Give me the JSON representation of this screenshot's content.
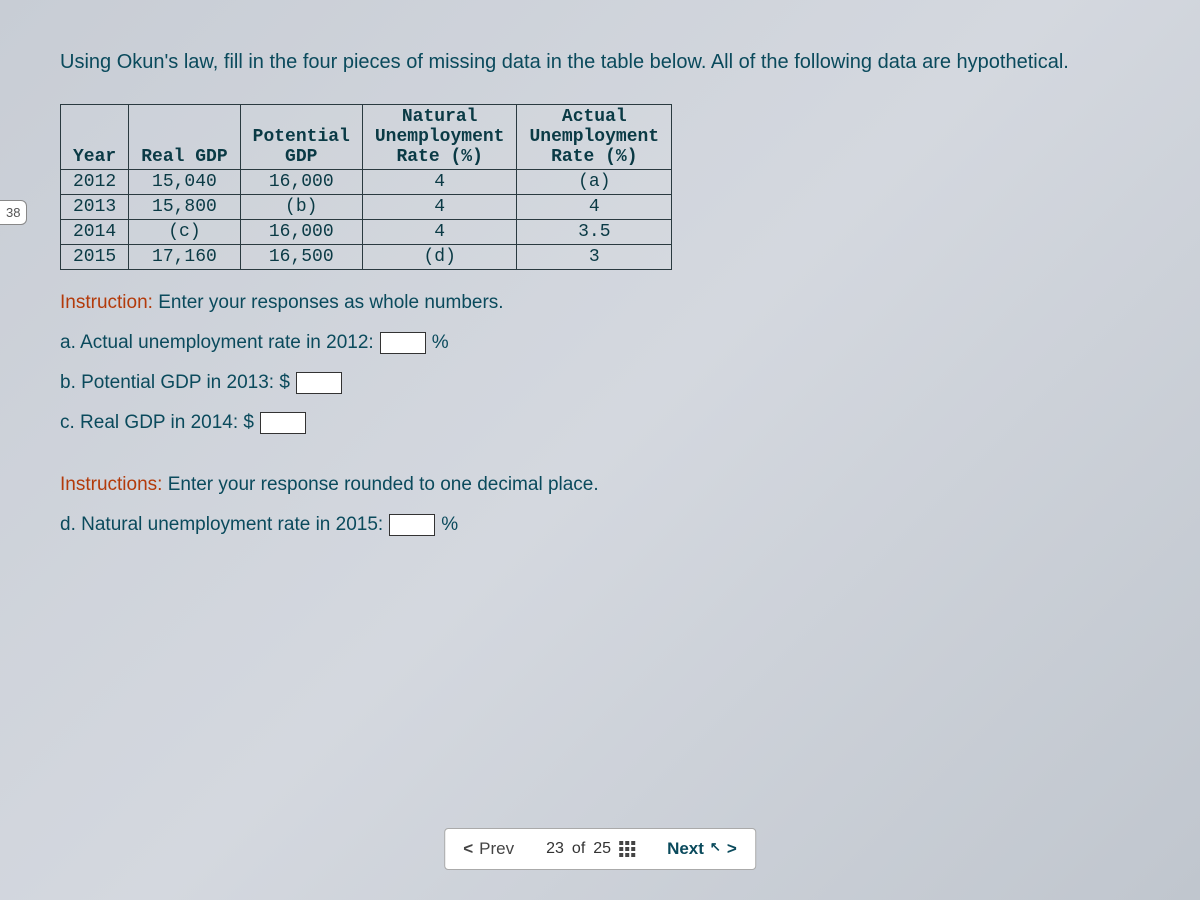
{
  "pageBadge": "38",
  "title": "Using Okun's law, fill in the four pieces of missing data in the table below. All of the following data are hypothetical.",
  "table": {
    "headers": {
      "year": "Year",
      "realGdp": "Real GDP",
      "potentialGdp": "Potential GDP",
      "naturalUnemp": "Natural Unemployment Rate (%)",
      "actualUnemp": "Actual Unemployment Rate (%)"
    },
    "rows": [
      {
        "year": "2012",
        "realGdp": "15,040",
        "potentialGdp": "16,000",
        "naturalUnemp": "4",
        "actualUnemp": "(a)"
      },
      {
        "year": "2013",
        "realGdp": "15,800",
        "potentialGdp": "(b)",
        "naturalUnemp": "4",
        "actualUnemp": "4"
      },
      {
        "year": "2014",
        "realGdp": "(c)",
        "potentialGdp": "16,000",
        "naturalUnemp": "4",
        "actualUnemp": "3.5"
      },
      {
        "year": "2015",
        "realGdp": "17,160",
        "potentialGdp": "16,500",
        "naturalUnemp": "(d)",
        "actualUnemp": "3"
      }
    ]
  },
  "instruction1": {
    "label": "Instruction:",
    "text": " Enter your responses as whole numbers."
  },
  "questions": {
    "a": {
      "text": "a. Actual unemployment rate in 2012:",
      "suffix": "%"
    },
    "b": {
      "text": "b. Potential GDP in 2013: $",
      "suffix": ""
    },
    "c": {
      "text": "c. Real GDP in 2014: $",
      "suffix": ""
    },
    "d": {
      "text": "d. Natural unemployment rate in 2015:",
      "suffix": "%"
    }
  },
  "instruction2": {
    "label": "Instructions:",
    "text": " Enter your response rounded to one decimal place."
  },
  "nav": {
    "prev": "Prev",
    "next": "Next",
    "current": "23",
    "of": "of",
    "total": "25"
  }
}
